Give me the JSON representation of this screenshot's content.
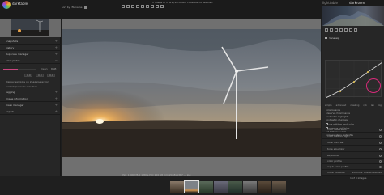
{
  "app": {
    "title": "darktable"
  },
  "toast": "1 image of 1 (#1) in current collection is selected",
  "toolbar": {
    "sort_label": "sort by",
    "sort_value": "filename"
  },
  "right_tabs": [
    "lighttable",
    "darkroom"
  ],
  "left_panel": {
    "sections": [
      "snapshots",
      "history",
      "duplicate manager",
      "color picker"
    ],
    "picker_mean": "mean",
    "picker_mean_value": "RGB",
    "picker_values": [
      "0.0",
      "0.0",
      "0.0"
    ],
    "lower_sections": [
      "display samples on image/selection",
      "restrict picker to selection",
      "tagging",
      "image information",
      "mask manager",
      "export"
    ]
  },
  "center": {
    "status": "DSC_1000 f/8.0 1/80 s  ISO 100  18 mm  2048x1367 — jpg"
  },
  "right_panel": {
    "module_name": "tone eq",
    "curve_tabs": [
      "simple",
      "advanced",
      "masking",
      "rgb",
      "lab",
      "log"
    ],
    "lines": [
      "color balance",
      "preserve chrominance",
      "contrast in highlights",
      "contrast in shadows",
      "use additive mode plus",
      "preserve highlights",
      "set bottom neutral",
      "compensate in highlights",
      "mix"
    ],
    "lines_values": [
      "",
      "",
      "",
      "",
      "",
      "",
      "",
      "",
      "0.5%"
    ],
    "modules": [
      "color calibration",
      "color balance rgb",
      "local contrast",
      "tone equalizer",
      "exposure",
      "color profile",
      "input color profile",
      "white balance",
      "raw black/white point"
    ],
    "footer": "more modules",
    "footer_value": "workflow: scene-referred"
  },
  "filmstrip": {
    "label": "1 of 8 images",
    "count": 8
  },
  "colors": {
    "accent": "#c8467f",
    "highlight": "#d82a7a"
  }
}
